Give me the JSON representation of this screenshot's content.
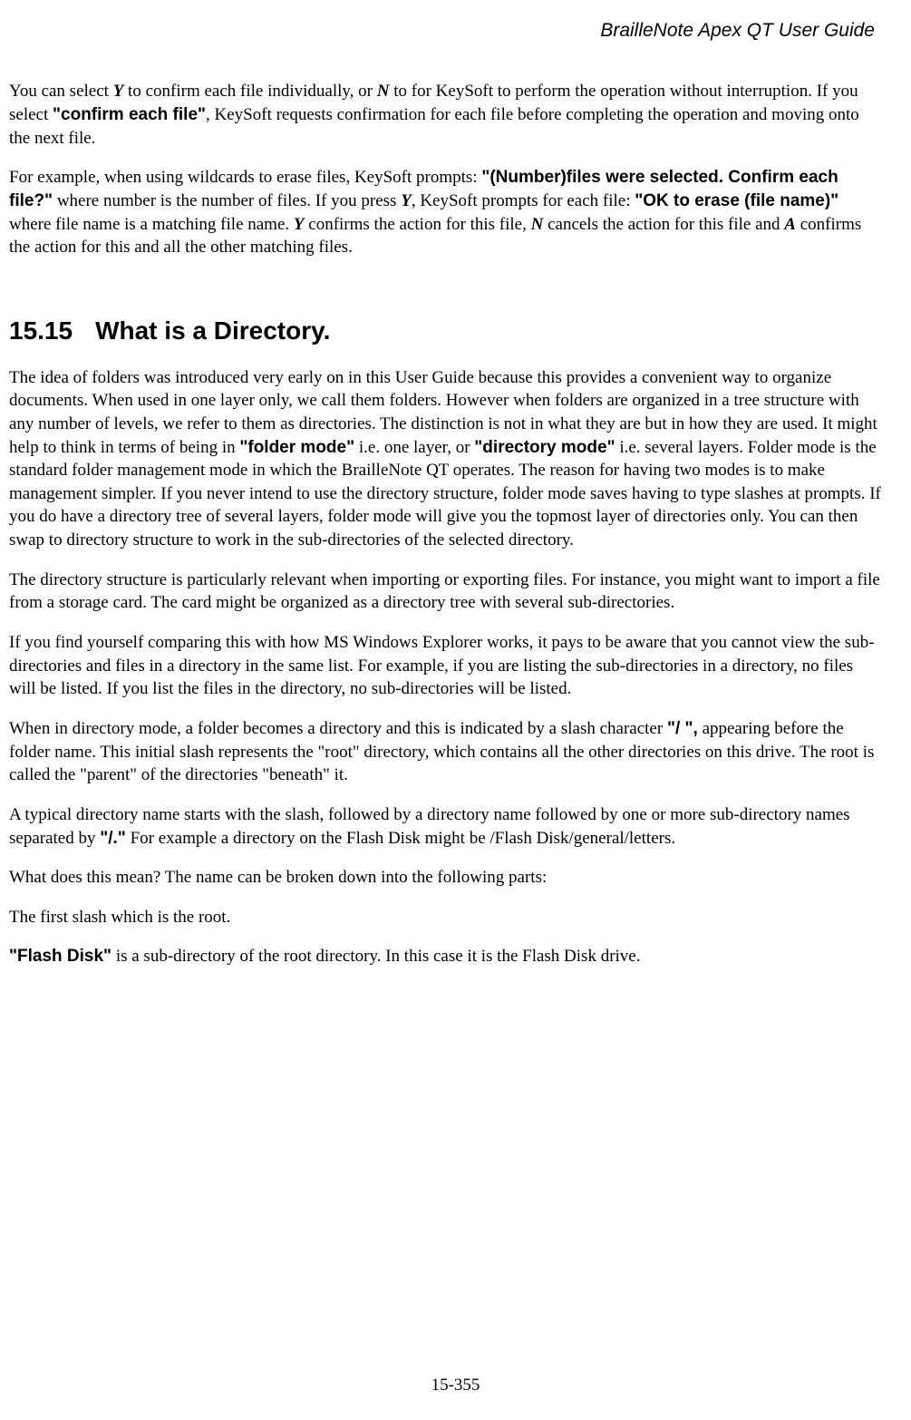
{
  "header": {
    "title": "BrailleNote Apex QT User Guide"
  },
  "body": {
    "p1": {
      "t1": "You can select ",
      "k1": "Y",
      "t2": " to confirm each file individually, or ",
      "k2": "N",
      "t3": " to for KeySoft to perform the operation without interruption. If you select ",
      "s1": "\"confirm each file\"",
      "t4": ", KeySoft requests confirmation for each file before completing the operation and moving onto the next file."
    },
    "p2": {
      "t1": "For example, when using wildcards to erase files, KeySoft prompts: ",
      "s1": "\"(Number)files were selected. Confirm each file?\"",
      "t2": " where number is the number of files. If you press ",
      "k1": "Y",
      "t3": ", KeySoft prompts for each file: ",
      "s2": "\"OK to erase (file name)\"",
      "t4": " where file name is a matching file name. ",
      "k2": "Y",
      "t5": " confirms the action for this file, ",
      "k3": "N",
      "t6": " cancels the action for this file and ",
      "k4": "A",
      "t7": " confirms the action for this and all the other matching files."
    },
    "heading": {
      "num": "15.15",
      "title": "What is a Directory."
    },
    "p3": {
      "t1": "The idea of folders was introduced very early on in this User Guide because this provides a convenient way to organize documents. When used in one layer only, we call them folders. However when folders are organized in a tree structure with any number of levels, we refer to them as directories. The distinction is not in what they are but in how they are used. It might help to think in terms of being in ",
      "s1": "\"folder mode\"",
      "t2": " i.e. one layer, or ",
      "s2": "\"directory mode\"",
      "t3": " i.e. several layers. Folder mode is the standard folder management mode in which the BrailleNote QT operates. The reason for having two modes is to make management simpler. If you never intend to use the directory structure, folder mode saves having to type slashes at prompts. If you do have a directory tree of several layers, folder mode will give you the topmost layer of directories only. You can then swap to directory structure to work in the sub-directories of the selected directory."
    },
    "p4": "The directory structure is particularly relevant when importing or exporting files. For instance, you might want to import a file from a storage card. The card might be organized as a directory tree with several sub-directories.",
    "p5": "If you find yourself comparing this with how MS Windows Explorer works, it pays to be aware that you cannot view the sub-directories and files in a directory in the same list. For example, if you are listing the sub-directories in a directory, no files will be listed. If you list the files in the directory, no sub-directories will be listed.",
    "p6": {
      "t1": "When in directory mode, a folder becomes a directory and this is indicated by a slash character ",
      "s1": "\"/ \",",
      "t2": " appearing before the folder name. This initial slash represents the \"root\" directory, which contains all the other directories on this drive. The root is called the \"parent\" of the directories \"beneath\" it."
    },
    "p7": {
      "t1": "A typical directory name starts with the slash, followed by a directory name followed by one or more sub-directory names separated by ",
      "s1": "\"/.\"",
      "t2": " For example a directory on the Flash Disk might be /Flash Disk/general/letters."
    },
    "p8": "What does this mean? The name can be broken down into the following parts:",
    "p9": "The first slash which is the root.",
    "p10": {
      "s1": "\"Flash Disk\"",
      "t1": " is a sub-directory of the root directory. In this case it is the Flash Disk drive."
    }
  },
  "footer": {
    "page": "15-355"
  }
}
